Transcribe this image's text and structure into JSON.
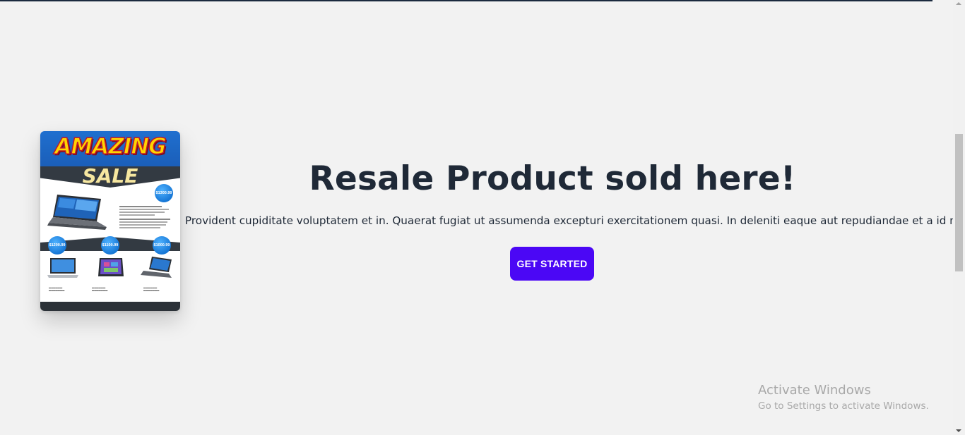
{
  "hero": {
    "title": "Resale Product sold here!",
    "description": "Provident cupiditate voluptatem et in. Quaerat fugiat ut assumenda excepturi exercitationem quasi. In deleniti eaque aut repudiandae et a id nisi.",
    "cta_label": "GET STARTED"
  },
  "flyer": {
    "headline": "AMAZING",
    "subheadline": "SALE",
    "prices": [
      "$1300.99",
      "$1200.99",
      "$1100.99",
      "$1000.99"
    ]
  },
  "watermark": {
    "title": "Activate Windows",
    "subtitle": "Go to Settings to activate Windows."
  },
  "colors": {
    "background": "#f2f2f2",
    "cta": "#4b07f5",
    "title_text": "#1f2937"
  }
}
